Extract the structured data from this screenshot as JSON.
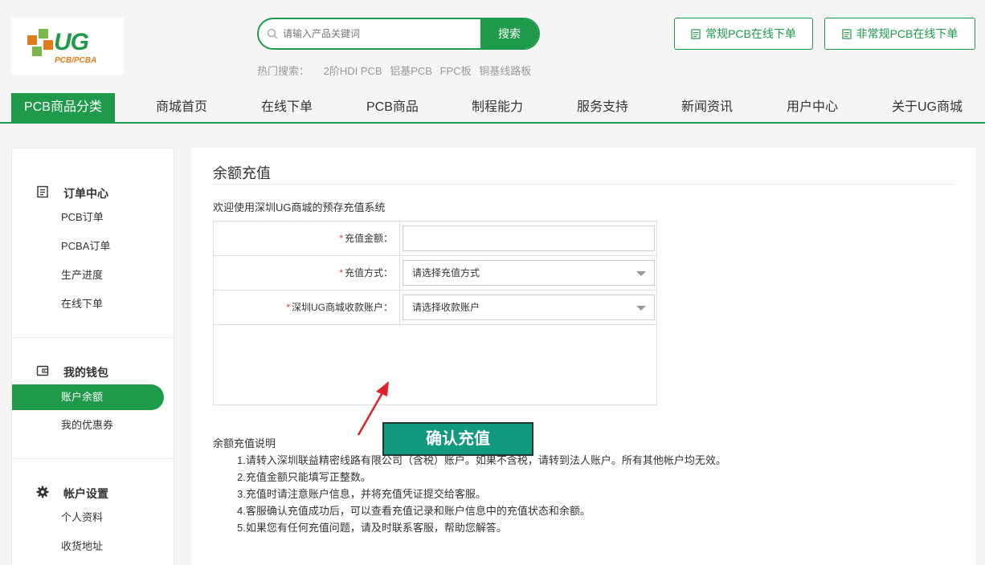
{
  "logo": {
    "text": "UG",
    "subtitle": "PCB/PCBA"
  },
  "search": {
    "placeholder": "请输入产品关键词",
    "button": "搜索"
  },
  "hot": {
    "label": "热门搜索：",
    "items": [
      "2阶HDI PCB",
      "铝基PCB",
      "FPC板",
      "铜基线路板"
    ]
  },
  "header_buttons": [
    "常规PCB在线下单",
    "非常规PCB在线下单"
  ],
  "nav": {
    "category": "PCB商品分类",
    "items": [
      "商城首页",
      "在线下单",
      "PCB商品",
      "制程能力",
      "服务支持",
      "新闻资讯",
      "用户中心",
      "关于UG商城"
    ]
  },
  "sidebar": {
    "sections": [
      {
        "title": "订单中心",
        "icon": "order-list-icon",
        "items": [
          "PCB订单",
          "PCBA订单",
          "生产进度",
          "在线下单"
        ]
      },
      {
        "title": "我的钱包",
        "icon": "wallet-icon",
        "items": [
          "账户余额",
          "我的优惠券"
        ],
        "active": "账户余额"
      },
      {
        "title": "帐户设置",
        "icon": "gear-icon",
        "items": [
          "个人资料",
          "收货地址"
        ]
      }
    ]
  },
  "main": {
    "title": "余额充值",
    "welcome": "欢迎使用深圳UG商城的预存充值系统",
    "form": {
      "amount_label": "充值金额：",
      "amount_value": "",
      "method_label": "充值方式：",
      "method_value": "请选择充值方式",
      "account_label": "深圳UG商城收款账户：",
      "account_value": "请选择收款账户",
      "confirm": "确认充值"
    },
    "notes": {
      "title": "余额充值说明",
      "lines": [
        "1.请转入深圳联益精密线路有限公司（含税）账户。如果不含税，请转到法人账户。所有其他帐户均无效。",
        "2.充值金额只能填写正整数。",
        "3.充值时请注意账户信息，并将充值凭证提交给客服。",
        "4.客服确认充值成功后，可以查看充值记录和账户信息中的充值状态和余额。",
        "5.如果您有任何充值问题，请及时联系客服，帮助您解答。"
      ]
    }
  },
  "colors": {
    "brand": "#1e9a4a",
    "confirm": "#129a7f",
    "arrow": "#e0202a",
    "required": "#e33333"
  }
}
